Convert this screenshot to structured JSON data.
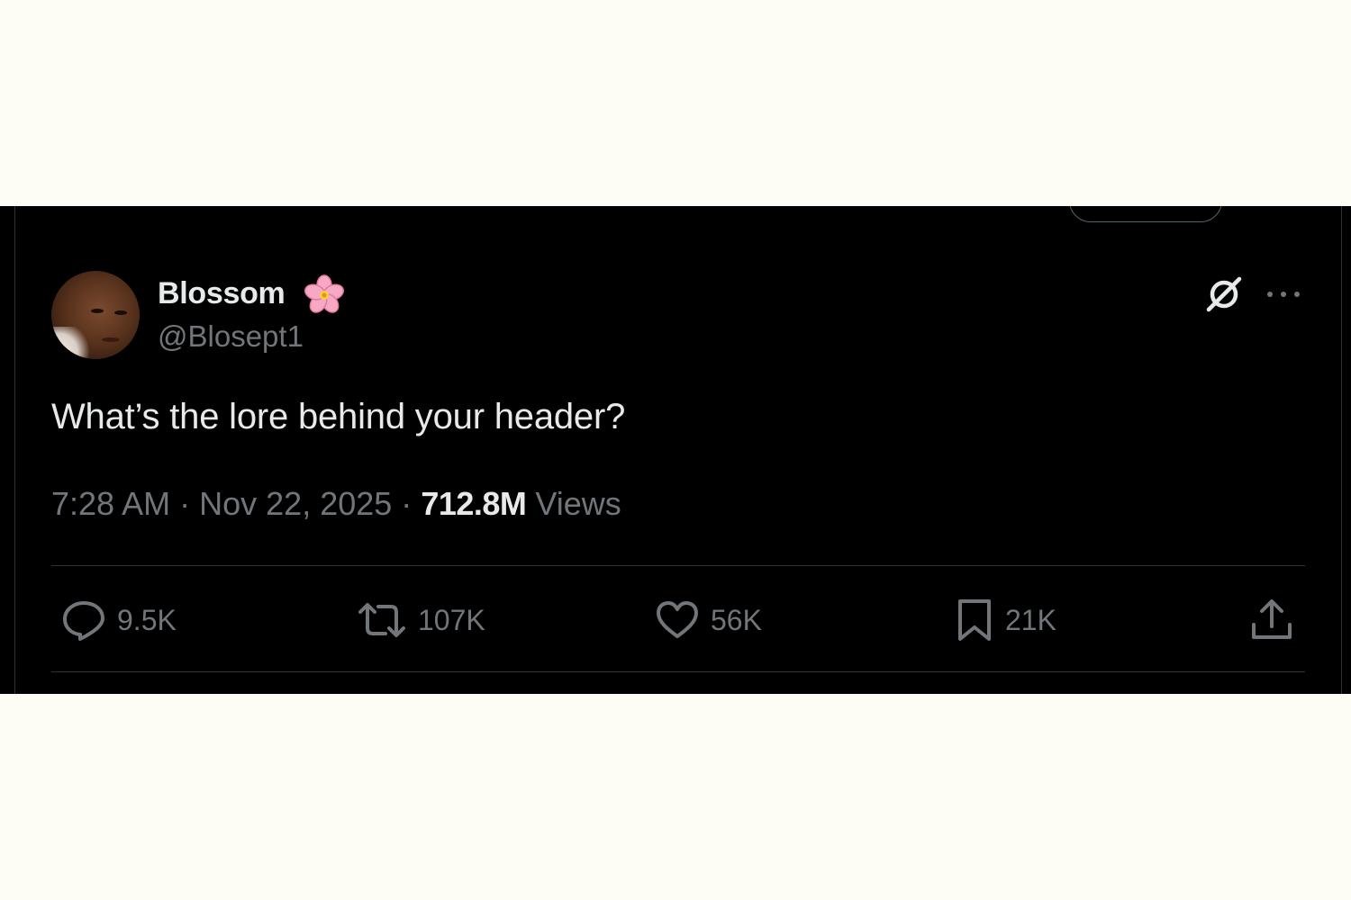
{
  "post": {
    "author": {
      "display_name": "Blossom",
      "handle": "@Blosept1",
      "name_emoji": "cherry-blossom-icon"
    },
    "text": "What’s the lore behind your header?",
    "meta": {
      "time": "7:28 AM",
      "separator": "·",
      "date": "Nov 22, 2025",
      "views_count": "712.8M",
      "views_label": "Views"
    },
    "actions": {
      "replies": "9.5K",
      "reposts": "107K",
      "likes": "56K",
      "bookmarks": "21K"
    },
    "header_icons": [
      "grok-icon",
      "more-icon"
    ]
  },
  "colors": {
    "background": "#000000",
    "page_background": "#fdfdf5",
    "primary_text": "#e7e9ea",
    "secondary_text": "#71767b",
    "border": "#2f3336"
  }
}
